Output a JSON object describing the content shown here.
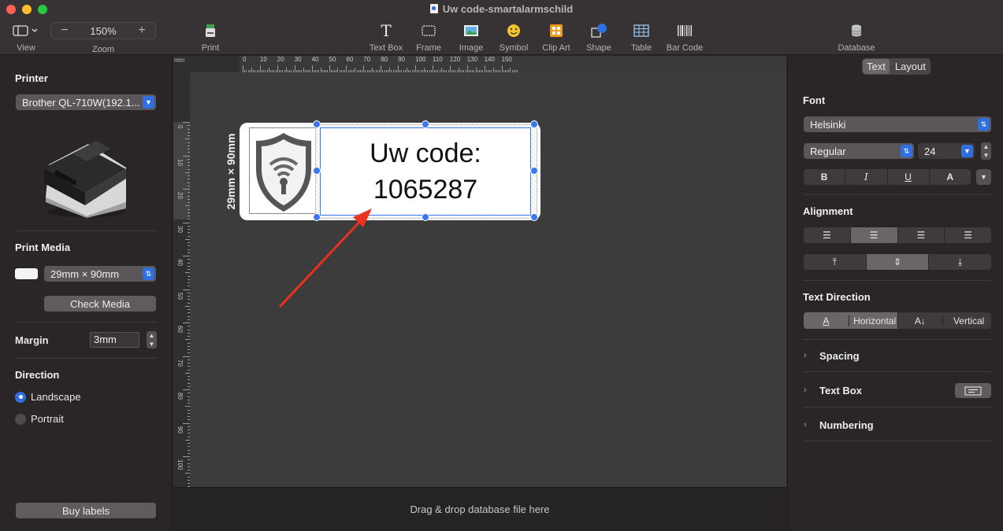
{
  "window": {
    "title": "Uw code-smartalarmschild"
  },
  "toolbar": {
    "view_label": "View",
    "zoom_label": "Zoom",
    "zoom_minus": "−",
    "zoom_value": "150%",
    "zoom_plus": "+",
    "print_label": "Print",
    "items": [
      {
        "label": "Text Box",
        "icon": "text-box-icon"
      },
      {
        "label": "Frame",
        "icon": "frame-icon"
      },
      {
        "label": "Image",
        "icon": "image-icon"
      },
      {
        "label": "Symbol",
        "icon": "symbol-icon"
      },
      {
        "label": "Clip Art",
        "icon": "clip-art-icon"
      },
      {
        "label": "Shape",
        "icon": "shape-icon"
      },
      {
        "label": "Table",
        "icon": "table-icon"
      },
      {
        "label": "Bar Code",
        "icon": "bar-code-icon"
      }
    ],
    "database_label": "Database"
  },
  "left": {
    "printer_heading": "Printer",
    "printer_value": "Brother QL-710W(192.1...",
    "media_heading": "Print Media",
    "media_value": "29mm × 90mm",
    "check_media": "Check Media",
    "margin_label": "Margin",
    "margin_value": "3mm",
    "direction_heading": "Direction",
    "landscape": "Landscape",
    "portrait": "Portrait",
    "buy_labels": "Buy labels"
  },
  "ruler": {
    "unit": "mm",
    "h_ticks": [
      "0",
      "10",
      "20",
      "30",
      "40",
      "50",
      "60",
      "70",
      "80",
      "90",
      "100",
      "110",
      "120",
      "130",
      "140",
      "150"
    ],
    "v_ticks": [
      "0",
      "10",
      "20",
      "30",
      "40",
      "50",
      "60",
      "70",
      "80",
      "90",
      "100"
    ]
  },
  "label": {
    "size_text": "29mm × 90mm",
    "line1": "Uw code:",
    "line2": "1065287"
  },
  "bottom": {
    "drop_hint": "Drag & drop database file here"
  },
  "right": {
    "tab_text": "Text",
    "tab_layout": "Layout",
    "font_heading": "Font",
    "font_family": "Helsinki",
    "font_style": "Regular",
    "font_size": "24",
    "style_bold": "B",
    "style_italic": "I",
    "style_underline": "U",
    "style_case": "A",
    "alignment_heading": "Alignment",
    "text_direction_heading": "Text Direction",
    "horizontal": "Horizontal",
    "vertical": "Vertical",
    "spacing": "Spacing",
    "text_box": "Text Box",
    "numbering": "Numbering"
  },
  "colors": {
    "accent": "#2f6fe0",
    "arrow": "#e8321e",
    "selection": "#3b78f0"
  }
}
